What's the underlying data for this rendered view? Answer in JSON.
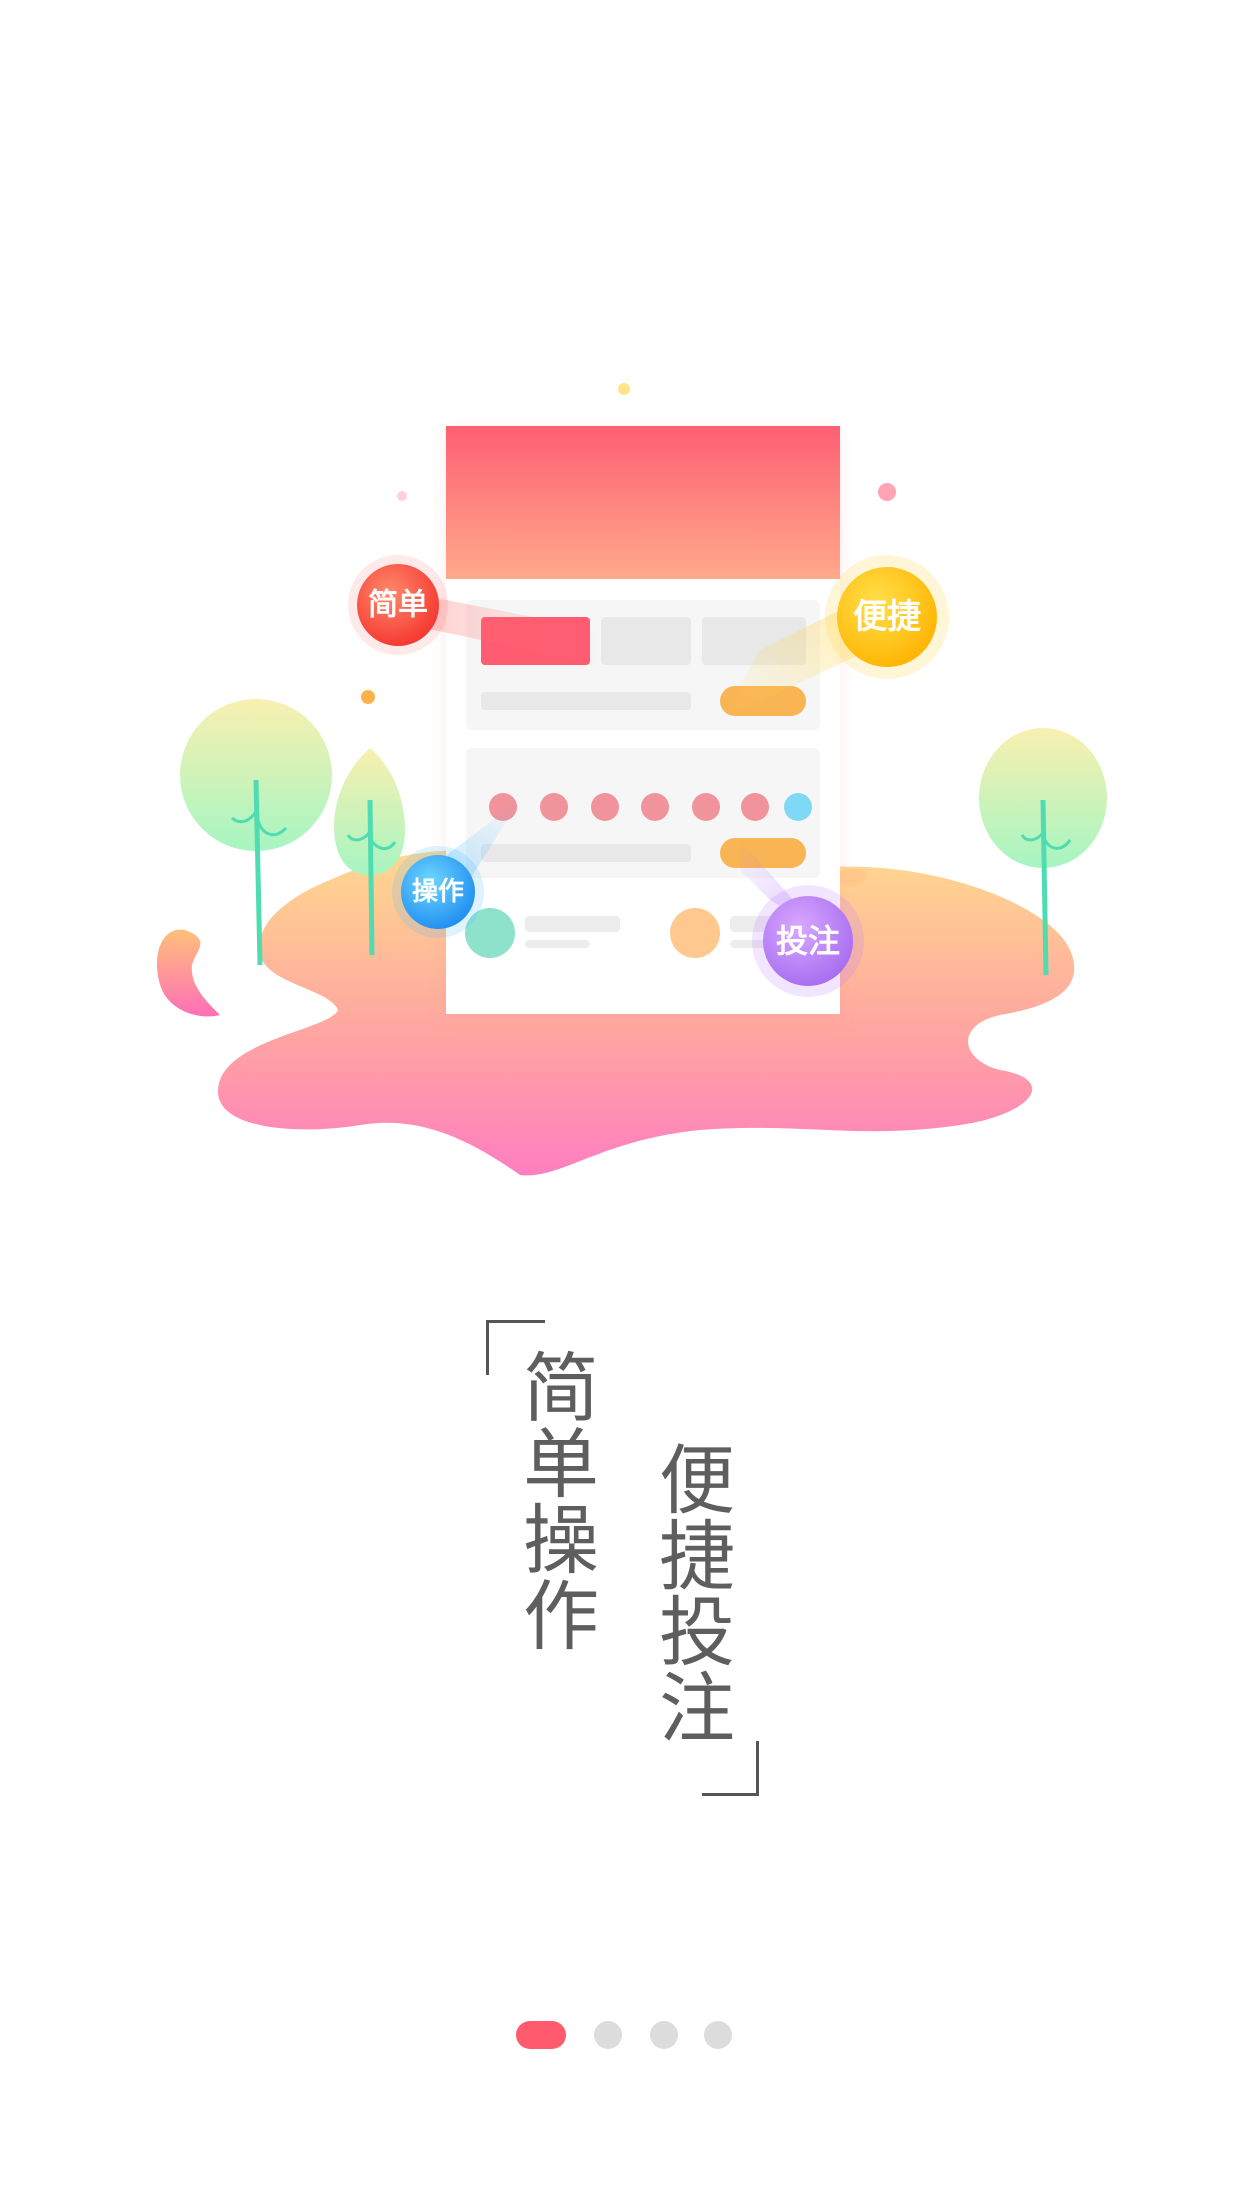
{
  "colors": {
    "accent": "#ff5a6e",
    "text": "#5e5e5e",
    "dot_inactive": "#dcdcdc"
  },
  "illustration": {
    "badges": {
      "simple": "简单",
      "convenient": "便捷",
      "operate": "操作",
      "bet": "投注"
    }
  },
  "slogan": {
    "line1": "简单操作",
    "line2": "便捷投注"
  },
  "pager": {
    "total": 4,
    "active_index": 0
  }
}
